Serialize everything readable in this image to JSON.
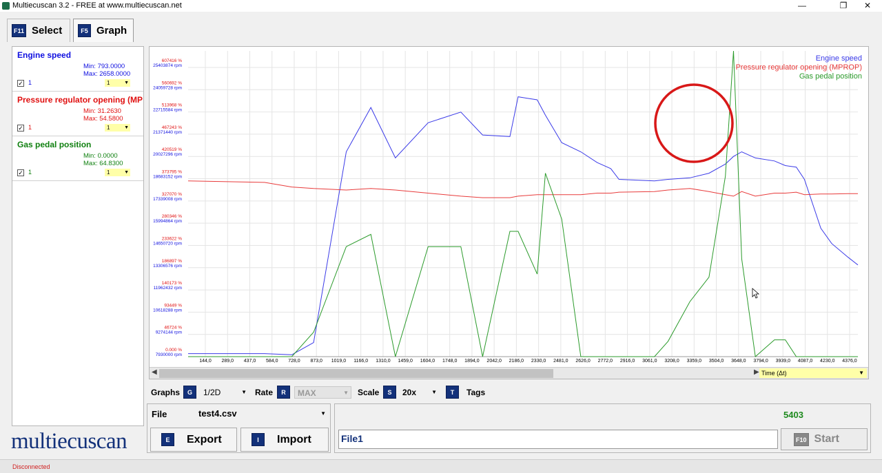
{
  "window": {
    "title": "Multiecuscan 3.2 - FREE at www.multiecuscan.net",
    "minimize": "—",
    "maximize": "❐",
    "close": "✕"
  },
  "tabs": [
    {
      "key": "F11",
      "label": "Select"
    },
    {
      "key": "F5",
      "label": "Graph"
    }
  ],
  "signals": [
    {
      "name": "Engine speed",
      "min": "Min: 793.0000",
      "max": "Max: 2658.0000",
      "num": "1",
      "mini": "1",
      "color": "#1010e0"
    },
    {
      "name": "Pressure regulator opening (MP",
      "min": "Min: 31.2630",
      "max": "Max: 54.5800",
      "num": "1",
      "mini": "1",
      "color": "#e01010"
    },
    {
      "name": "Gas pedal position",
      "min": "Min: 0.0000",
      "max": "Max: 64.8300",
      "num": "1",
      "mini": "1",
      "color": "#108010"
    }
  ],
  "chart_data": {
    "type": "line",
    "xlabel": "Time (Δt)",
    "x_ticks": [
      "144,0",
      "289,0",
      "437,0",
      "584,0",
      "728,0",
      "873,0",
      "1019,0",
      "1166,0",
      "1310,0",
      "1459,0",
      "1604,0",
      "1748,0",
      "1894,0",
      "2042,0",
      "2186,0",
      "2330,0",
      "2481,0",
      "2626,0",
      "2772,0",
      "2916,0",
      "3061,0",
      "3208,0",
      "3359,0",
      "3504,0",
      "3648,0",
      "3794,0",
      "3939,0",
      "4087,0",
      "4230,0",
      "4376,0"
    ],
    "y_ticks_percent": [
      "607416 %",
      "560692 %",
      "513968 %",
      "467243 %",
      "420519 %",
      "373795 %",
      "327070 %",
      "280346 %",
      "233622 %",
      "186897 %",
      "140173 %",
      "93449 %",
      "46724 %",
      "0.000 %"
    ],
    "y_ticks_rpm": [
      "25403874 rpm",
      "24059728 rpm",
      "22715584 rpm",
      "21371440 rpm",
      "20027296 rpm",
      "18683152 rpm",
      "17339008 rpm",
      "15994864 rpm",
      "14650720 rpm",
      "13306576 rpm",
      "11962432 rpm",
      "10618288 rpm",
      "9274144 rpm",
      "7930000 rpm"
    ],
    "legend": [
      "Engine speed",
      "Pressure regulator opening (MPROP)",
      "Gas pedal position"
    ],
    "legend_position": "top-right",
    "grid": true,
    "x": [
      0,
      140,
      190,
      230,
      290,
      335,
      380,
      440,
      500,
      540,
      590,
      605,
      640,
      655,
      685,
      720,
      750,
      775,
      790,
      855,
      880,
      920,
      955,
      985,
      1000,
      1015,
      1040,
      1075,
      1095,
      1115,
      1130,
      1160,
      1180,
      1210,
      1228
    ],
    "series": [
      {
        "name": "Engine speed",
        "color": "#3a3ae8",
        "values": [
          1.0,
          1.0,
          0.6,
          4.6,
          67.0,
          81.5,
          65.0,
          76.5,
          80.0,
          72.5,
          72.0,
          85.0,
          84.0,
          79.0,
          70.0,
          67.0,
          63.5,
          61.5,
          58.0,
          57.5,
          58.0,
          58.5,
          60.0,
          63.0,
          65.5,
          67.0,
          65.0,
          64.0,
          62.5,
          62.0,
          58.0,
          42.0,
          37.0,
          32.5,
          30.0
        ]
      },
      {
        "name": "Pressure regulator opening (MPROP)",
        "color": "#e83a3a",
        "values": [
          57.5,
          57.0,
          55.5,
          55.0,
          54.5,
          55.0,
          54.5,
          53.5,
          52.5,
          52.0,
          52.0,
          52.5,
          53.0,
          53.0,
          53.0,
          53.0,
          53.5,
          53.5,
          53.8,
          54.0,
          54.5,
          55.0,
          54.0,
          53.0,
          52.5,
          54.0,
          52.5,
          53.5,
          53.5,
          53.8,
          53.0,
          53.2,
          53.2,
          53.3,
          53.3
        ]
      },
      {
        "name": "Gas pedal position",
        "color": "#2a9a2a",
        "values": [
          0.0,
          0.0,
          0.0,
          8.0,
          36.0,
          40.0,
          0.0,
          36.0,
          36.0,
          0.0,
          41.0,
          41.0,
          27.0,
          60.0,
          45.0,
          0.0,
          0.0,
          0.0,
          0.0,
          0.0,
          5.0,
          18.0,
          26.0,
          59.0,
          100.0,
          32.0,
          0.0,
          5.5,
          5.5,
          0.0,
          0.0,
          0.0,
          0.0,
          0.0,
          0.0
        ]
      }
    ]
  },
  "toolbar": {
    "graphs_label": "Graphs",
    "graphs_key": "G",
    "graphs_value": "1/2D",
    "rate_label": "Rate",
    "rate_key": "R",
    "rate_value": "MAX",
    "scale_label": "Scale",
    "scale_key": "S",
    "scale_value": "20x",
    "tags_label": "Tags",
    "tags_key": "T"
  },
  "file": {
    "label": "File",
    "value": "test4.csv"
  },
  "buttons": {
    "export_key": "E",
    "export_label": "Export",
    "import_key": "I",
    "import_label": "Import",
    "start_key": "F10",
    "start_label": "Start"
  },
  "status": {
    "counter": "5403",
    "file_name": "File1",
    "connection": "Disconnected"
  },
  "logo_text": "multiecuscan"
}
